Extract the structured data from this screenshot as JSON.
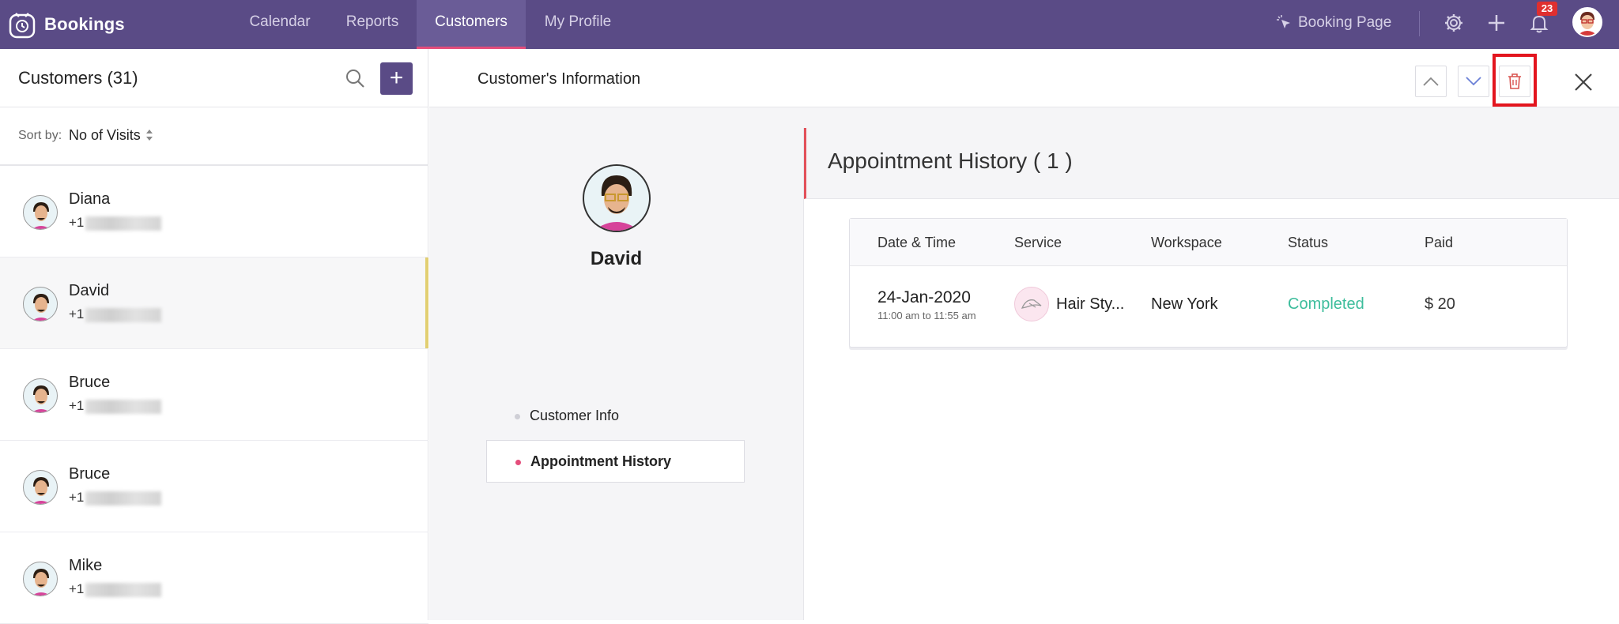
{
  "app": {
    "name": "Bookings"
  },
  "nav": {
    "tabs": [
      {
        "label": "Calendar"
      },
      {
        "label": "Reports"
      },
      {
        "label": "Customers",
        "active": true
      },
      {
        "label": "My Profile"
      }
    ],
    "booking_page_label": "Booking Page",
    "notification_count": "23"
  },
  "customers": {
    "title": "Customers (31)",
    "sort_label": "Sort by:",
    "sort_value": "No of Visits",
    "items": [
      {
        "name": "Diana",
        "phone_prefix": "+1"
      },
      {
        "name": "David",
        "phone_prefix": "+1",
        "selected": true
      },
      {
        "name": "Bruce",
        "phone_prefix": "+1"
      },
      {
        "name": "Bruce",
        "phone_prefix": "+1"
      },
      {
        "name": "Mike",
        "phone_prefix": "+1"
      }
    ]
  },
  "detail": {
    "title": "Customer's Information",
    "customer_name": "David",
    "side_links": [
      {
        "label": "Customer Info"
      },
      {
        "label": "Appointment History",
        "active": true
      }
    ],
    "history": {
      "title": "Appointment History ( 1 )",
      "columns": [
        "Date & Time",
        "Service",
        "Workspace",
        "Status",
        "Paid"
      ],
      "rows": [
        {
          "date": "24-Jan-2020",
          "time": "11:00 am to 11:55 am",
          "service": "Hair Sty...",
          "workspace": "New York",
          "status": "Completed",
          "paid": "$ 20"
        }
      ]
    }
  },
  "colors": {
    "nav_bg": "#5a4b86",
    "accent": "#e44d7b",
    "status_completed": "#3dbd9c",
    "highlight_box": "#e3151e"
  }
}
